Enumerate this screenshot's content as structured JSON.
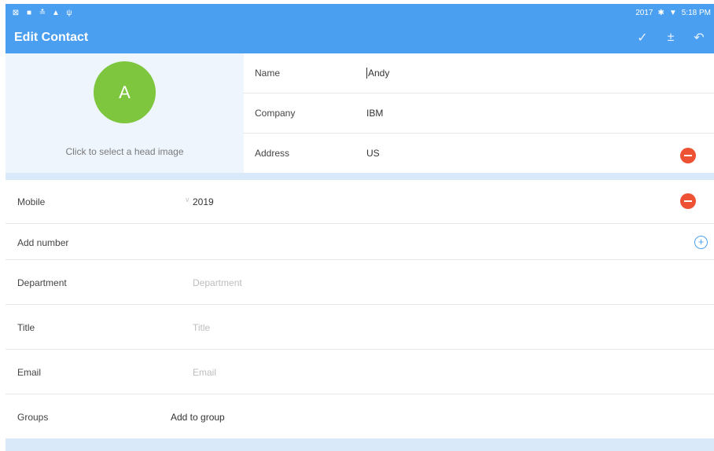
{
  "statusbar": {
    "left_icons": [
      "notification-icon",
      "message-icon",
      "app-icon",
      "warning-icon",
      "usb-icon"
    ],
    "left_glyphs": [
      "⊠",
      "■",
      "≛",
      "▲",
      "ψ"
    ],
    "time_label": "2017",
    "time": "5:18 PM",
    "bluetooth_glyph": "✱",
    "wifi_glyph": "▼"
  },
  "appbar": {
    "title": "Edit Contact",
    "confirm_glyph": "✓",
    "add_field_glyph": "±",
    "back_glyph": "↶"
  },
  "head": {
    "avatar_letter": "A",
    "hint": "Click to select a head image"
  },
  "info": {
    "name_label": "Name",
    "name_value": "Andy",
    "company_label": "Company",
    "company_value": "IBM",
    "address_label": "Address",
    "address_value": "US"
  },
  "fields": {
    "mobile_label": "Mobile",
    "mobile_value": "2019",
    "add_number_label": "Add number",
    "department_label": "Department",
    "department_placeholder": "Department",
    "title_label": "Title",
    "title_placeholder": "Title",
    "email_label": "Email",
    "email_placeholder": "Email",
    "groups_label": "Groups",
    "groups_value": "Add to group"
  },
  "colors": {
    "accent": "#4a9ff0",
    "avatar": "#7dc63d",
    "delete": "#ec5233",
    "panel": "#eef5fd",
    "separator": "#d9e9f9"
  }
}
